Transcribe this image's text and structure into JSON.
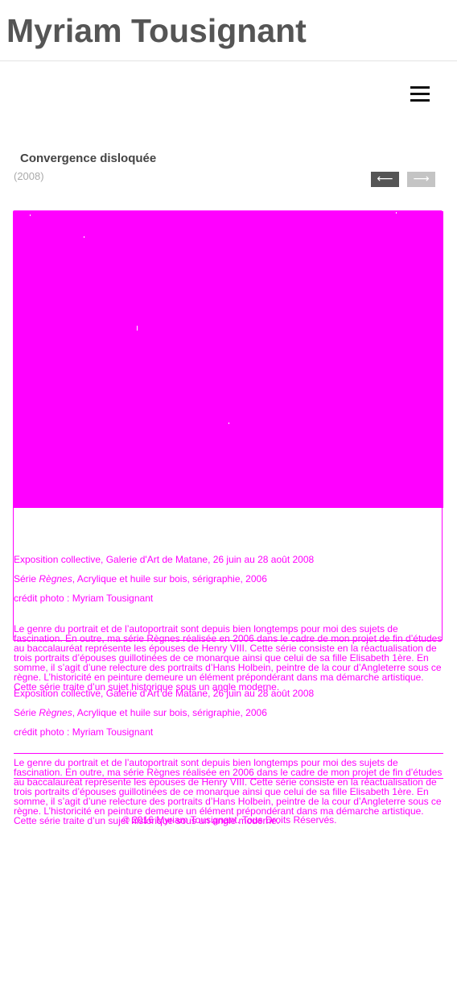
{
  "site": {
    "title": "Myriam Tousignant"
  },
  "header": {
    "menu_icon": "hamburger-icon"
  },
  "work": {
    "title": "Convergence disloquée",
    "year": "(2008)",
    "nav": {
      "prev": "⟵",
      "next": "⟶"
    }
  },
  "artwork": {
    "color": "#ff00ff"
  },
  "details": {
    "exhibition": "Exposition collective, Galerie d'Art de Matane, 26 juin au 28 août 2008",
    "series_prefix": "Série ",
    "series_name": "Règnes",
    "series_suffix": ", Acrylique et huile sur bois, sérigraphie, 2006",
    "photo_credit": "crédit photo : Myriam Tousignant",
    "description": "Le genre du portrait et de l’autoportrait sont depuis bien longtemps pour moi des sujets de fascination. En outre, ma série Règnes réalisée en 2006 dans le cadre de mon projet de fin d’études au baccalauréat représente les épouses de Henry VIII. Cette série consiste en la réactualisation de trois portraits d’épouses guillotinées de ce monarque ainsi que celui de sa fille Elisabeth 1ère. En somme, il s’agit d’une relecture des portraits d’Hans Holbein, peintre de la cour d’Angleterre sous ce règne. L’historicité en peinture demeure un élément prépondérant dans ma démarche artistique. Cette série traite d’un sujet historique sous un angle moderne."
  },
  "footer": {
    "copyright": "© 2016 Myriam Tousignant. Tous Droits Réservés."
  }
}
